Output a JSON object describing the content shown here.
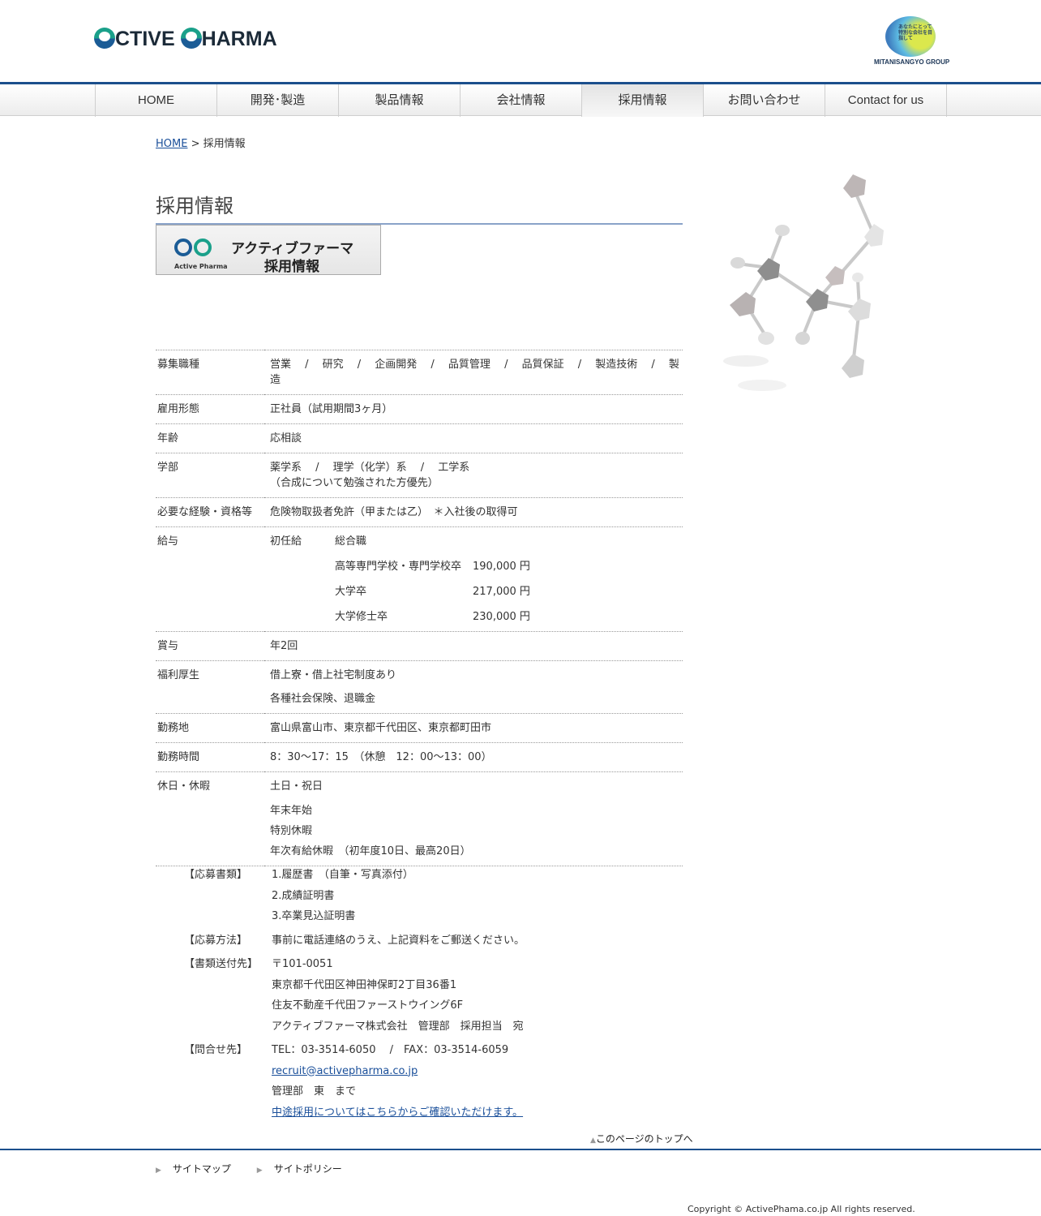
{
  "header": {
    "logo": "ACTIVE PHARMA",
    "logo_parts": [
      "CTIVE ",
      "HARMA"
    ],
    "group_tagline": "あなたにとって特別な会社を目指して",
    "group_name": "MITANISANGYO GROUP"
  },
  "nav": [
    {
      "label": "HOME"
    },
    {
      "label": "開発･製造"
    },
    {
      "label": "製品情報"
    },
    {
      "label": "会社情報"
    },
    {
      "label": "採用情報"
    },
    {
      "label": "お問い合わせ"
    },
    {
      "label": "Contact for us"
    }
  ],
  "breadcrumb": {
    "home": "HOME",
    "sep": " > ",
    "current": "採用情報"
  },
  "page_title": "採用情報",
  "banner": {
    "sub": "Active Pharma",
    "line1": "アクティブファーマ",
    "line2": "採用情報"
  },
  "table": {
    "job_types": {
      "label": "募集職種",
      "value": "営業　 /　 研究　 /　 企画開発　 /　 品質管理　 /　 品質保証　 /　 製造技術　 /　 製造"
    },
    "employment": {
      "label": "雇用形態",
      "value": "正社員（試用期間3ヶ月）"
    },
    "age": {
      "label": "年齢",
      "value": "応相談"
    },
    "faculty": {
      "label": "学部",
      "line1": "薬学系　 /　 理学（化学）系　 /　 工学系",
      "line2": "（合成について勉強された方優先）"
    },
    "qualification": {
      "label": "必要な経験・資格等",
      "value": "危険物取扱者免許（甲または乙）　＊入社後の取得可"
    },
    "salary": {
      "label": "給与",
      "head": "初任給",
      "category": "総合職",
      "rows": [
        {
          "edu": "高等専門学校・専門学校卒",
          "amount": "190,000 円"
        },
        {
          "edu": "大学卒",
          "amount": "217,000 円"
        },
        {
          "edu": "大学修士卒",
          "amount": "230,000 円"
        }
      ]
    },
    "bonus": {
      "label": "賞与",
      "value": "年2回"
    },
    "welfare": {
      "label": "福利厚生",
      "line1": "借上寮・借上社宅制度あり",
      "line2": "各種社会保険、退職金"
    },
    "location": {
      "label": "勤務地",
      "value": "富山県富山市、東京都千代田区、東京都町田市"
    },
    "hours": {
      "label": "勤務時間",
      "value": "8：30〜17：15　（休憩　12：00〜13：00）"
    },
    "holidays": {
      "label": "休日・休暇",
      "lines": [
        "土日・祝日",
        "年末年始",
        "特別休暇",
        "年次有給休暇　（初年度10日、最高20日）"
      ]
    }
  },
  "apply": {
    "docs": {
      "label": "【応募書類】",
      "lines": [
        "1.履歴書　（自筆・写真添付）",
        "2.成績証明書",
        "3.卒業見込証明書"
      ]
    },
    "method": {
      "label": "【応募方法】",
      "value": "事前に電話連絡のうえ、上記資料をご郵送ください。"
    },
    "address": {
      "label": "【書類送付先】",
      "lines": [
        "〒101-0051",
        "東京都千代田区神田神保町2丁目36番1",
        "住友不動産千代田ファーストウイング6F",
        "アクティブファーマ株式会社　管理部　採用担当　宛"
      ]
    },
    "contact": {
      "label": "【問合せ先】",
      "tel": "TEL：03-3514-6050　 /　FAX：03-3514-6059",
      "email": "recruit@activepharma.co.jp",
      "person": "管理部　東　まで",
      "midcareer": "中途採用についてはこちらからご確認いただけます。"
    }
  },
  "to_top": "このページのトップへ",
  "footer": {
    "sitemap": "サイトマップ",
    "policy": "サイトポリシー",
    "copyright": "Copyright © ActivePhama.co.jp All rights reserved."
  }
}
